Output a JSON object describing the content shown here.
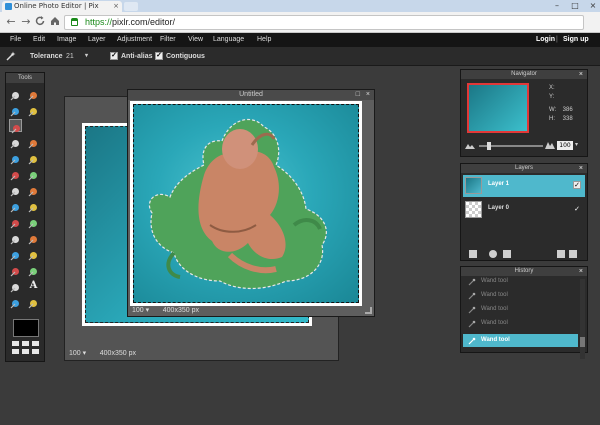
{
  "browser": {
    "tab_title": "Online Photo Editor | Pix",
    "tab_close": "×",
    "url_scheme": "https://",
    "url_rest": "pixlr.com/editor/",
    "back": "←",
    "forward": "→",
    "reload": "C",
    "home": "⌂"
  },
  "menu": {
    "items": [
      "File",
      "Edit",
      "Image",
      "Layer",
      "Adjustment",
      "Filter",
      "View",
      "Language",
      "Help"
    ],
    "login": "Login",
    "separator": "|",
    "signup": "Sign up"
  },
  "options": {
    "tolerance_label": "Tolerance",
    "tolerance_value": "21",
    "antialias_label": "Anti-alias",
    "contiguous_label": "Contiguous",
    "antialias_checked": true,
    "contiguous_checked": true
  },
  "tools": {
    "title": "Tools",
    "active_tool": "magic-wand",
    "icons": [
      "crop-icon",
      "move-icon",
      "marquee-icon",
      "lasso-icon",
      "magic-wand-icon",
      "blank",
      "pencil-icon",
      "brush-icon",
      "eraser-icon",
      "bucket-icon",
      "gradient-icon",
      "clone-stamp-icon",
      "color-replace-icon",
      "drawing-icon",
      "spot-heal-icon",
      "bloat-icon",
      "pinch-icon",
      "red-eye-icon",
      "sponge-icon",
      "blur-icon",
      "sharpen-icon",
      "smudge-icon",
      "dodge-icon",
      "burn-icon",
      "eyedropper-icon",
      "text-icon",
      "hand-icon",
      "zoom-icon"
    ],
    "text_tool_glyph": "A",
    "primary_color": "#000000"
  },
  "doc_back": {
    "zoom": "100",
    "size": "400x350 px"
  },
  "doc_front": {
    "title": "Untitled",
    "zoom": "100",
    "size": "400x350 px",
    "max_btn": "□",
    "close_btn": "×"
  },
  "navigator": {
    "title": "Navigator",
    "close": "×",
    "x_label": "X:",
    "y_label": "Y:",
    "w_label": "W:",
    "h_label": "H:",
    "w_value": "386",
    "h_value": "338",
    "zoom_value": "100",
    "zoom_dropdown": "▾"
  },
  "layers": {
    "title": "Layers",
    "close": "×",
    "items": [
      {
        "name": "Layer 1",
        "visible": true,
        "active": true
      },
      {
        "name": "Layer 0",
        "visible": true,
        "active": false
      }
    ]
  },
  "history": {
    "title": "History",
    "close": "×",
    "items": [
      "Wand tool",
      "Wand tool",
      "Wand tool",
      "Wand tool",
      "Wand tool"
    ],
    "active_item": "Wand tool"
  },
  "colors": {
    "accent": "#4fb8cc",
    "nav_frame": "#e23838"
  }
}
